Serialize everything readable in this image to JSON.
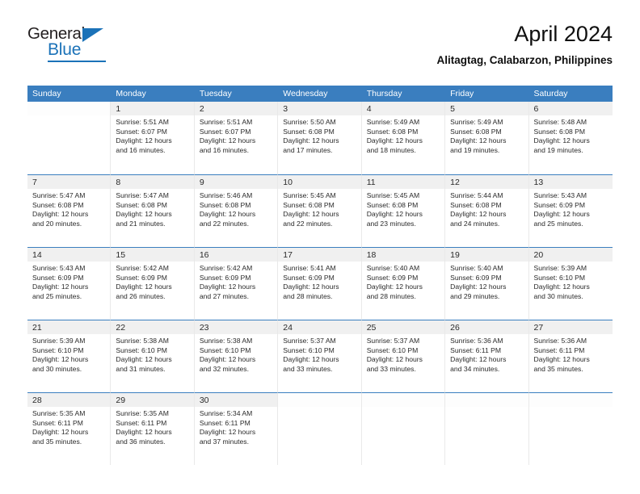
{
  "brand": {
    "name_primary": "General",
    "name_secondary": "Blue",
    "accent_color": "#1b72b8"
  },
  "header": {
    "title": "April 2024",
    "subtitle": "Alitagtag, Calabarzon, Philippines"
  },
  "calendar": {
    "header_color": "#3a7ebf",
    "weekday_headers": [
      "Sunday",
      "Monday",
      "Tuesday",
      "Wednesday",
      "Thursday",
      "Friday",
      "Saturday"
    ],
    "weeks": [
      [
        {
          "day": "",
          "sunrise": "",
          "sunset": "",
          "daylight_line1": "",
          "daylight_line2": ""
        },
        {
          "day": "1",
          "sunrise": "Sunrise: 5:51 AM",
          "sunset": "Sunset: 6:07 PM",
          "daylight_line1": "Daylight: 12 hours",
          "daylight_line2": "and 16 minutes."
        },
        {
          "day": "2",
          "sunrise": "Sunrise: 5:51 AM",
          "sunset": "Sunset: 6:07 PM",
          "daylight_line1": "Daylight: 12 hours",
          "daylight_line2": "and 16 minutes."
        },
        {
          "day": "3",
          "sunrise": "Sunrise: 5:50 AM",
          "sunset": "Sunset: 6:08 PM",
          "daylight_line1": "Daylight: 12 hours",
          "daylight_line2": "and 17 minutes."
        },
        {
          "day": "4",
          "sunrise": "Sunrise: 5:49 AM",
          "sunset": "Sunset: 6:08 PM",
          "daylight_line1": "Daylight: 12 hours",
          "daylight_line2": "and 18 minutes."
        },
        {
          "day": "5",
          "sunrise": "Sunrise: 5:49 AM",
          "sunset": "Sunset: 6:08 PM",
          "daylight_line1": "Daylight: 12 hours",
          "daylight_line2": "and 19 minutes."
        },
        {
          "day": "6",
          "sunrise": "Sunrise: 5:48 AM",
          "sunset": "Sunset: 6:08 PM",
          "daylight_line1": "Daylight: 12 hours",
          "daylight_line2": "and 19 minutes."
        }
      ],
      [
        {
          "day": "7",
          "sunrise": "Sunrise: 5:47 AM",
          "sunset": "Sunset: 6:08 PM",
          "daylight_line1": "Daylight: 12 hours",
          "daylight_line2": "and 20 minutes."
        },
        {
          "day": "8",
          "sunrise": "Sunrise: 5:47 AM",
          "sunset": "Sunset: 6:08 PM",
          "daylight_line1": "Daylight: 12 hours",
          "daylight_line2": "and 21 minutes."
        },
        {
          "day": "9",
          "sunrise": "Sunrise: 5:46 AM",
          "sunset": "Sunset: 6:08 PM",
          "daylight_line1": "Daylight: 12 hours",
          "daylight_line2": "and 22 minutes."
        },
        {
          "day": "10",
          "sunrise": "Sunrise: 5:45 AM",
          "sunset": "Sunset: 6:08 PM",
          "daylight_line1": "Daylight: 12 hours",
          "daylight_line2": "and 22 minutes."
        },
        {
          "day": "11",
          "sunrise": "Sunrise: 5:45 AM",
          "sunset": "Sunset: 6:08 PM",
          "daylight_line1": "Daylight: 12 hours",
          "daylight_line2": "and 23 minutes."
        },
        {
          "day": "12",
          "sunrise": "Sunrise: 5:44 AM",
          "sunset": "Sunset: 6:08 PM",
          "daylight_line1": "Daylight: 12 hours",
          "daylight_line2": "and 24 minutes."
        },
        {
          "day": "13",
          "sunrise": "Sunrise: 5:43 AM",
          "sunset": "Sunset: 6:09 PM",
          "daylight_line1": "Daylight: 12 hours",
          "daylight_line2": "and 25 minutes."
        }
      ],
      [
        {
          "day": "14",
          "sunrise": "Sunrise: 5:43 AM",
          "sunset": "Sunset: 6:09 PM",
          "daylight_line1": "Daylight: 12 hours",
          "daylight_line2": "and 25 minutes."
        },
        {
          "day": "15",
          "sunrise": "Sunrise: 5:42 AM",
          "sunset": "Sunset: 6:09 PM",
          "daylight_line1": "Daylight: 12 hours",
          "daylight_line2": "and 26 minutes."
        },
        {
          "day": "16",
          "sunrise": "Sunrise: 5:42 AM",
          "sunset": "Sunset: 6:09 PM",
          "daylight_line1": "Daylight: 12 hours",
          "daylight_line2": "and 27 minutes."
        },
        {
          "day": "17",
          "sunrise": "Sunrise: 5:41 AM",
          "sunset": "Sunset: 6:09 PM",
          "daylight_line1": "Daylight: 12 hours",
          "daylight_line2": "and 28 minutes."
        },
        {
          "day": "18",
          "sunrise": "Sunrise: 5:40 AM",
          "sunset": "Sunset: 6:09 PM",
          "daylight_line1": "Daylight: 12 hours",
          "daylight_line2": "and 28 minutes."
        },
        {
          "day": "19",
          "sunrise": "Sunrise: 5:40 AM",
          "sunset": "Sunset: 6:09 PM",
          "daylight_line1": "Daylight: 12 hours",
          "daylight_line2": "and 29 minutes."
        },
        {
          "day": "20",
          "sunrise": "Sunrise: 5:39 AM",
          "sunset": "Sunset: 6:10 PM",
          "daylight_line1": "Daylight: 12 hours",
          "daylight_line2": "and 30 minutes."
        }
      ],
      [
        {
          "day": "21",
          "sunrise": "Sunrise: 5:39 AM",
          "sunset": "Sunset: 6:10 PM",
          "daylight_line1": "Daylight: 12 hours",
          "daylight_line2": "and 30 minutes."
        },
        {
          "day": "22",
          "sunrise": "Sunrise: 5:38 AM",
          "sunset": "Sunset: 6:10 PM",
          "daylight_line1": "Daylight: 12 hours",
          "daylight_line2": "and 31 minutes."
        },
        {
          "day": "23",
          "sunrise": "Sunrise: 5:38 AM",
          "sunset": "Sunset: 6:10 PM",
          "daylight_line1": "Daylight: 12 hours",
          "daylight_line2": "and 32 minutes."
        },
        {
          "day": "24",
          "sunrise": "Sunrise: 5:37 AM",
          "sunset": "Sunset: 6:10 PM",
          "daylight_line1": "Daylight: 12 hours",
          "daylight_line2": "and 33 minutes."
        },
        {
          "day": "25",
          "sunrise": "Sunrise: 5:37 AM",
          "sunset": "Sunset: 6:10 PM",
          "daylight_line1": "Daylight: 12 hours",
          "daylight_line2": "and 33 minutes."
        },
        {
          "day": "26",
          "sunrise": "Sunrise: 5:36 AM",
          "sunset": "Sunset: 6:11 PM",
          "daylight_line1": "Daylight: 12 hours",
          "daylight_line2": "and 34 minutes."
        },
        {
          "day": "27",
          "sunrise": "Sunrise: 5:36 AM",
          "sunset": "Sunset: 6:11 PM",
          "daylight_line1": "Daylight: 12 hours",
          "daylight_line2": "and 35 minutes."
        }
      ],
      [
        {
          "day": "28",
          "sunrise": "Sunrise: 5:35 AM",
          "sunset": "Sunset: 6:11 PM",
          "daylight_line1": "Daylight: 12 hours",
          "daylight_line2": "and 35 minutes."
        },
        {
          "day": "29",
          "sunrise": "Sunrise: 5:35 AM",
          "sunset": "Sunset: 6:11 PM",
          "daylight_line1": "Daylight: 12 hours",
          "daylight_line2": "and 36 minutes."
        },
        {
          "day": "30",
          "sunrise": "Sunrise: 5:34 AM",
          "sunset": "Sunset: 6:11 PM",
          "daylight_line1": "Daylight: 12 hours",
          "daylight_line2": "and 37 minutes."
        },
        {
          "day": "",
          "sunrise": "",
          "sunset": "",
          "daylight_line1": "",
          "daylight_line2": ""
        },
        {
          "day": "",
          "sunrise": "",
          "sunset": "",
          "daylight_line1": "",
          "daylight_line2": ""
        },
        {
          "day": "",
          "sunrise": "",
          "sunset": "",
          "daylight_line1": "",
          "daylight_line2": ""
        },
        {
          "day": "",
          "sunrise": "",
          "sunset": "",
          "daylight_line1": "",
          "daylight_line2": ""
        }
      ]
    ]
  }
}
